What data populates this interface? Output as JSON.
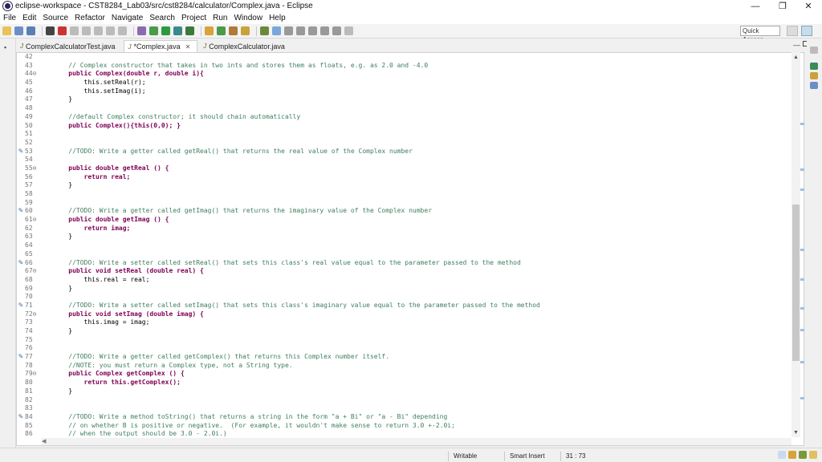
{
  "window": {
    "title": "eclipse-workspace - CST8284_Lab03/src/cst8284/calculator/Complex.java - Eclipse",
    "minimize": "—",
    "maximize": "❐",
    "close": "✕"
  },
  "menu": [
    "File",
    "Edit",
    "Source",
    "Refactor",
    "Navigate",
    "Search",
    "Project",
    "Run",
    "Window",
    "Help"
  ],
  "toolbar": {
    "quick_access": "Quick Access"
  },
  "tabs": [
    {
      "label": "ComplexCalculatorTest.java",
      "active": false,
      "dirty": false
    },
    {
      "label": "*Complex.java",
      "active": true,
      "dirty": true
    },
    {
      "label": "ComplexCalculator.java",
      "active": false,
      "dirty": false
    }
  ],
  "editor": {
    "lines": [
      {
        "n": "42",
        "t": "",
        "m": ""
      },
      {
        "n": "43",
        "t": "    // Complex constructor that takes in two ints and stores them as floats, e.g. as 2.0 and -4.0",
        "m": ""
      },
      {
        "n": "44⊖",
        "t": "    public Complex(double r, double i){",
        "m": ""
      },
      {
        "n": "45",
        "t": "        this.setReal(r);",
        "m": ""
      },
      {
        "n": "46",
        "t": "        this.setImag(i);",
        "m": ""
      },
      {
        "n": "47",
        "t": "    }",
        "m": ""
      },
      {
        "n": "48",
        "t": "",
        "m": ""
      },
      {
        "n": "49",
        "t": "    //default Complex constructor; it should chain automatically",
        "m": ""
      },
      {
        "n": "50",
        "t": "    public Complex(){this(0,0); }",
        "m": ""
      },
      {
        "n": "51",
        "t": "",
        "m": ""
      },
      {
        "n": "52",
        "t": "",
        "m": ""
      },
      {
        "n": "53",
        "t": "    //TODO: Write a getter called getReal() that returns the real value of the Complex number",
        "m": "✎"
      },
      {
        "n": "54",
        "t": "",
        "m": ""
      },
      {
        "n": "55⊖",
        "t": "    public double getReal () {",
        "m": ""
      },
      {
        "n": "56",
        "t": "        return real;",
        "m": ""
      },
      {
        "n": "57",
        "t": "    }",
        "m": ""
      },
      {
        "n": "58",
        "t": "",
        "m": ""
      },
      {
        "n": "59",
        "t": "",
        "m": ""
      },
      {
        "n": "60",
        "t": "    //TODO: Write a getter called getImag() that returns the imaginary value of the Complex number",
        "m": "✎"
      },
      {
        "n": "61⊖",
        "t": "    public double getImag () {",
        "m": ""
      },
      {
        "n": "62",
        "t": "        return imag;",
        "m": ""
      },
      {
        "n": "63",
        "t": "    }",
        "m": ""
      },
      {
        "n": "64",
        "t": "",
        "m": ""
      },
      {
        "n": "65",
        "t": "",
        "m": ""
      },
      {
        "n": "66",
        "t": "    //TODO: Write a setter called setReal() that sets this class's real value equal to the parameter passed to the method",
        "m": "✎"
      },
      {
        "n": "67⊖",
        "t": "    public void setReal (double real) {",
        "m": ""
      },
      {
        "n": "68",
        "t": "        this.real = real;",
        "m": ""
      },
      {
        "n": "69",
        "t": "    }",
        "m": ""
      },
      {
        "n": "70",
        "t": "",
        "m": ""
      },
      {
        "n": "71",
        "t": "    //TODO: Write a setter called setImag() that sets this class's imaginary value equal to the parameter passed to the method",
        "m": "✎"
      },
      {
        "n": "72⊖",
        "t": "    public void setImag (double imag) {",
        "m": ""
      },
      {
        "n": "73",
        "t": "        this.imag = imag;",
        "m": ""
      },
      {
        "n": "74",
        "t": "    }",
        "m": ""
      },
      {
        "n": "75",
        "t": "",
        "m": ""
      },
      {
        "n": "76",
        "t": "",
        "m": ""
      },
      {
        "n": "77",
        "t": "    //TODO: Write a getter called getComplex() that returns this Complex number itself.",
        "m": "✎"
      },
      {
        "n": "78",
        "t": "    //NOTE: you must return a Complex type, not a String type.",
        "m": ""
      },
      {
        "n": "79⊖",
        "t": "    public Complex getComplex () {",
        "m": ""
      },
      {
        "n": "80",
        "t": "        return this.getComplex();",
        "m": ""
      },
      {
        "n": "81",
        "t": "    }",
        "m": ""
      },
      {
        "n": "82",
        "t": "",
        "m": ""
      },
      {
        "n": "83",
        "t": "",
        "m": ""
      },
      {
        "n": "84",
        "t": "    //TODO: Write a method toString() that returns a string in the form \"a + Bi\" or \"a - Bi\" depending",
        "m": "✎"
      },
      {
        "n": "85",
        "t": "    // on whether B is positive or negative.  (For example, it wouldn't make sense to return 3.0 +-2.0i;",
        "m": ""
      },
      {
        "n": "86",
        "t": "    // when the output should be 3.0 - 2.0i.)",
        "m": ""
      }
    ]
  },
  "status": {
    "writable": "Writable",
    "insert_mode": "Smart Insert",
    "position": "31 : 73"
  },
  "colors": {
    "comment": "#3f7f5f",
    "keyword": "#7f0055",
    "accent": "#3a6ea5"
  }
}
